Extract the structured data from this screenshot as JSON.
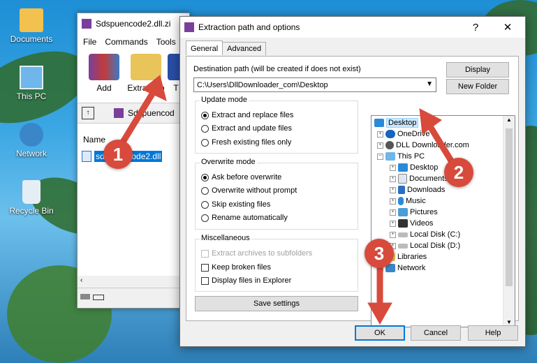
{
  "desktop": {
    "icons": [
      {
        "label": "Documents",
        "icon": "folder-user-icon"
      },
      {
        "label": "This PC",
        "icon": "computer-icon"
      },
      {
        "label": "Network",
        "icon": "network-icon"
      },
      {
        "label": "Recycle Bin",
        "icon": "recycle-bin-icon"
      }
    ]
  },
  "winrar": {
    "title": "Sdspuencode2.dll.zi",
    "menu": [
      "File",
      "Commands",
      "Tools"
    ],
    "toolbar": {
      "add": "Add",
      "extract_to": "Extract To",
      "partial": "T"
    },
    "address": "Sdspuencod",
    "column_name": "Name",
    "file": "sdspuencode2.dll"
  },
  "dialog": {
    "title": "Extraction path and options",
    "help_symbol": "?",
    "close_symbol": "✕",
    "tabs": [
      "General",
      "Advanced"
    ],
    "dest_label": "Destination path (will be created if does not exist)",
    "dest_value": "C:\\Users\\DllDownloader_com\\Desktop",
    "display_btn": "Display",
    "new_folder_btn": "New Folder",
    "update_mode": {
      "title": "Update mode",
      "options": [
        "Extract and replace files",
        "Extract and update files",
        "Fresh existing files only"
      ],
      "selected": 0
    },
    "overwrite_mode": {
      "title": "Overwrite mode",
      "options": [
        "Ask before overwrite",
        "Overwrite without prompt",
        "Skip existing files",
        "Rename automatically"
      ],
      "selected": 0
    },
    "misc": {
      "title": "Miscellaneous",
      "options": [
        "Extract archives to subfolders",
        "Keep broken files",
        "Display files in Explorer"
      ]
    },
    "save_settings": "Save settings",
    "tree": [
      "Desktop",
      "OneDrive",
      "DLL Downloader.com",
      "This PC",
      "Desktop",
      "Documents",
      "Downloads",
      "Music",
      "Pictures",
      "Videos",
      "Local Disk (C:)",
      "Local Disk (D:)",
      "Libraries",
      "Network"
    ],
    "ok": "OK",
    "cancel": "Cancel",
    "help": "Help"
  },
  "markers": [
    "1",
    "2",
    "3"
  ],
  "colors": {
    "marker": "#d84a3c",
    "selection": "#cce8ff",
    "accent": "#0078d7"
  }
}
